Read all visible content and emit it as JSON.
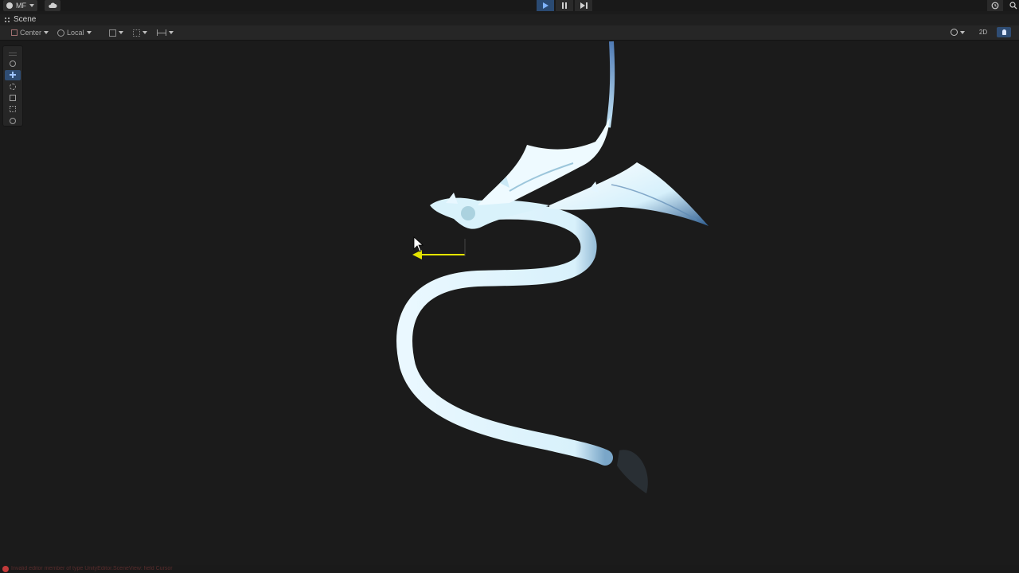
{
  "toolbar": {
    "account_label": "MF",
    "icons": {
      "account": "account-icon",
      "cloud": "cloud-icon",
      "play": "play-icon",
      "pause": "pause-icon",
      "step": "step-icon",
      "history": "history-icon",
      "search": "search-icon"
    },
    "play_active_color": "#2a4a72"
  },
  "window": {
    "tab_label": "Scene"
  },
  "scene_toolbar": {
    "pivot_mode_label": "Center",
    "pivot_rotation_label": "Local",
    "mode_2d_label": "2D"
  },
  "tools": [
    {
      "name": "hand-tool",
      "icon": "hand-icon",
      "active": false
    },
    {
      "name": "move-tool",
      "icon": "move-icon",
      "active": true
    },
    {
      "name": "rotate-tool",
      "icon": "rotate-icon",
      "active": false
    },
    {
      "name": "scale-tool",
      "icon": "scale-icon",
      "active": false
    },
    {
      "name": "rect-tool",
      "icon": "rect-icon",
      "active": false
    },
    {
      "name": "transform-tool",
      "icon": "transform-icon",
      "active": false
    }
  ],
  "viewport": {
    "object": "dragon-model",
    "gizmo_axis_color": "#e4e400",
    "accent_color": "#2f4d74"
  },
  "status": {
    "text": "Invalid editor member of type UnityEditor.SceneView: field Cursor"
  }
}
